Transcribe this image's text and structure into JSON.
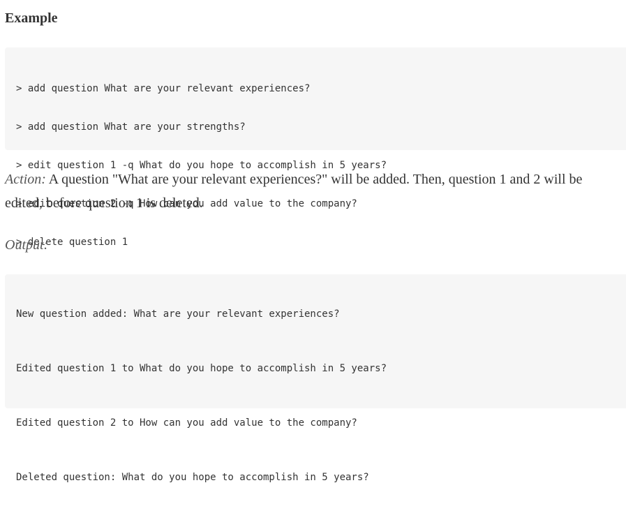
{
  "heading": "Example",
  "commands": [
    "> add question What are your relevant experiences?",
    "> add question What are your strengths?",
    "> edit question 1 -q What do you hope to accomplish in 5 years?",
    "> edit question 2 -q How can you add value to the company?",
    "> delete question 1"
  ],
  "action": {
    "label": "Action:",
    "text": " A question \"What are your relevant experiences?\" will be added. Then, question 1 and 2 will be edited, before question 1 is deleted."
  },
  "output_label": "Output:",
  "outputs": [
    "New question added: What are your relevant experiences?",
    "Edited question 1 to What do you hope to accomplish in 5 years?",
    "Edited question 2 to How can you add value to the company?",
    "Deleted question: What do you hope to accomplish in 5 years?"
  ]
}
